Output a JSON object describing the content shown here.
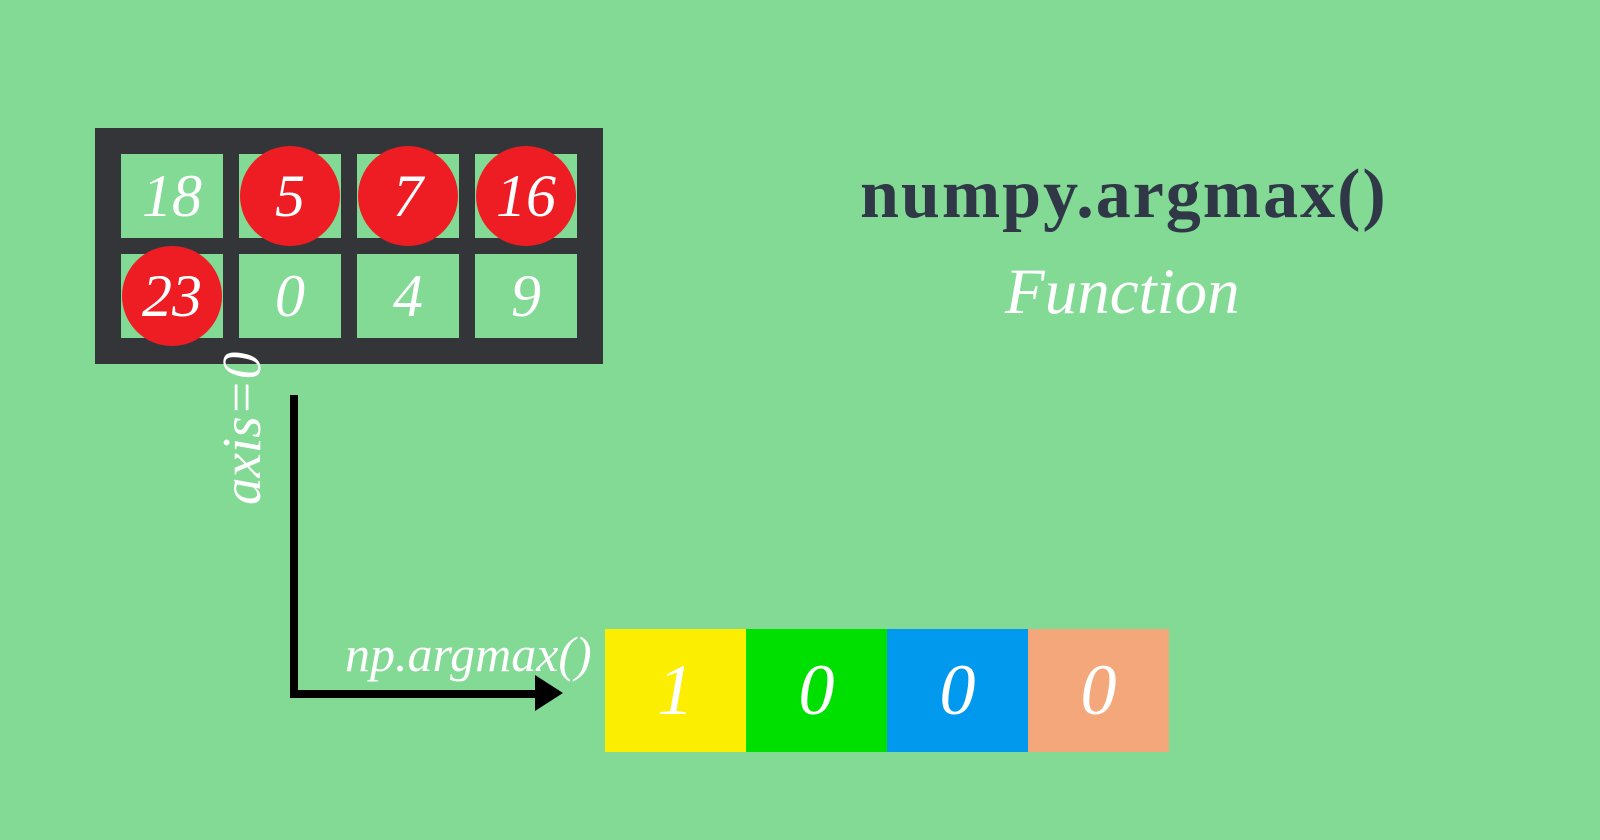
{
  "title": "numpy.argmax()",
  "subtitle": "Function",
  "axis_label": "axis=0",
  "function_call": "np.argmax()",
  "grid": {
    "rows": [
      [
        {
          "value": "18",
          "highlighted": false
        },
        {
          "value": "5",
          "highlighted": true
        },
        {
          "value": "7",
          "highlighted": true
        },
        {
          "value": "16",
          "highlighted": true
        }
      ],
      [
        {
          "value": "23",
          "highlighted": true
        },
        {
          "value": "0",
          "highlighted": false
        },
        {
          "value": "4",
          "highlighted": false
        },
        {
          "value": "9",
          "highlighted": false
        }
      ]
    ]
  },
  "result": [
    {
      "value": "1",
      "color": "#fcee00"
    },
    {
      "value": "0",
      "color": "#00e000"
    },
    {
      "value": "0",
      "color": "#0099ee"
    },
    {
      "value": "0",
      "color": "#f4a77a"
    }
  ]
}
